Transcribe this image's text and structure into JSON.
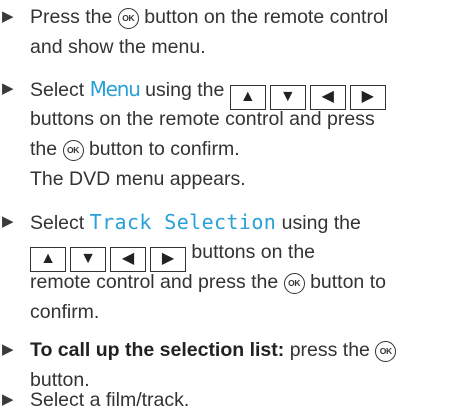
{
  "steps": [
    {
      "bullet": "▶",
      "l1a": "Press the",
      "ok": "OK",
      "l1b": "button on the remote control",
      "l2": "and show the menu."
    },
    {
      "bullet": "▶",
      "l1a": "Select",
      "highlight": "Menu",
      "l1b": "using the",
      "keys": [
        "▲",
        "▼",
        "◀",
        "▶"
      ],
      "l2": "buttons on the remote control and press",
      "l3a": "the",
      "ok": "OK",
      "l3b": "button to confirm.",
      "l4": "The DVD menu appears."
    },
    {
      "bullet": "▶",
      "l1a": "Select",
      "highlight": "Track Selection",
      "l1b": "using the",
      "keys": [
        "▲",
        "▼",
        "◀",
        "▶"
      ],
      "l2b": "buttons on the",
      "l3a": "remote control and press the",
      "ok": "OK",
      "l3b": "button to",
      "l4": "confirm."
    },
    {
      "bullet": "▶",
      "bold": "To call up the selection list:",
      "l1b": "press the",
      "ok": "OK",
      "l2": "button."
    },
    {
      "bullet": "▶",
      "l1": "Select a film/track."
    }
  ],
  "colors": {
    "highlight": "#2aa0d8",
    "text": "#333333"
  },
  "icons": {
    "bullet": "triangle-right-icon",
    "ok": "ok-button-icon",
    "keys": [
      "arrow-up-key-icon",
      "arrow-down-key-icon",
      "arrow-left-key-icon",
      "arrow-right-key-icon"
    ]
  }
}
